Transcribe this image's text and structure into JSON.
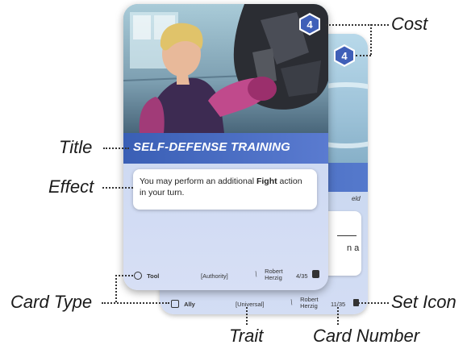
{
  "callouts": {
    "cost": "Cost",
    "title": "Title",
    "effect": "Effect",
    "card_type": "Card Type",
    "set_icon": "Set Icon",
    "trait": "Trait",
    "card_number": "Card Number"
  },
  "front_card": {
    "cost": "4",
    "title": "SELF-DEFENSE TRAINING",
    "effect_before": "You may perform an additional ",
    "effect_bold": "Fight",
    "effect_after": " action in your turn.",
    "type": "Tool",
    "trait": "[Authority]",
    "artist_label": "Robert",
    "artist_name": "Herzig",
    "number": "4/35"
  },
  "back_card": {
    "cost": "4",
    "effect_fragment_top": "eld",
    "effect_fragment_mid": "n a",
    "type": "Ally",
    "trait": "[Universal]",
    "artist_label": "Robert",
    "artist_name": "Herzig",
    "number": "11/35"
  },
  "colors": {
    "title_band": "#3a5fb5",
    "cost_badge": "#3f5fb8",
    "card_body": "#cdd9f2"
  }
}
